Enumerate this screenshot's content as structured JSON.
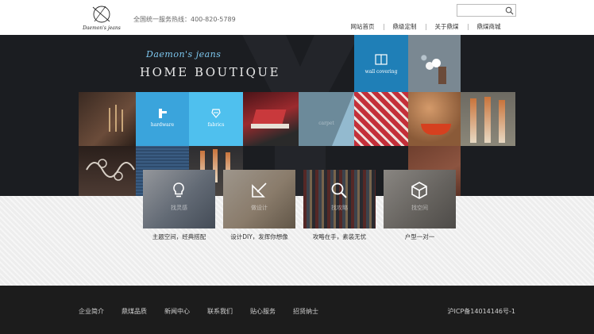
{
  "header": {
    "brand_logo": "Daemon's jeans",
    "hotline": "全国统一服务热线：400-820-5789",
    "search_placeholder": "",
    "nav": [
      {
        "label": "网站首页"
      },
      {
        "label": "鼎级定制"
      },
      {
        "label": "关于鼎煤"
      },
      {
        "label": "鼎煤商城"
      }
    ]
  },
  "hero": {
    "brand_script": "Daemon's jeans",
    "brand_big": "HOME BOUTIQUE",
    "tiles": [
      {
        "label": "wall covering",
        "icon": "book-icon"
      },
      {
        "label": "hardware",
        "icon": "hook-icon"
      },
      {
        "label": "fabrics",
        "icon": "fabric-icon"
      },
      {
        "label": "carpet",
        "icon": "carpet-icon"
      }
    ]
  },
  "features": [
    {
      "title": "找灵感",
      "caption": "主题空间，经典搭配",
      "icon": "lightbulb-icon"
    },
    {
      "title": "做设计",
      "caption": "设计DIY，发挥你想像",
      "icon": "design-icon"
    },
    {
      "title": "找攻略",
      "caption": "攻略在手，素装无忧",
      "icon": "search-icon"
    },
    {
      "title": "找空间",
      "caption": "户型一对一",
      "icon": "cube-icon"
    }
  ],
  "footer": {
    "links": [
      {
        "label": "企业简介"
      },
      {
        "label": "鼎煤品质"
      },
      {
        "label": "新闻中心"
      },
      {
        "label": "联系我们"
      },
      {
        "label": "贴心服务"
      },
      {
        "label": "招贤纳士"
      }
    ],
    "icp": "沪ICP备14014146号-1"
  },
  "colors": {
    "hero_bg": "#1b1d21",
    "accent_blue": "#4fb8e8",
    "deep_blue": "#1f7fb7",
    "footer_bg": "#1c1c1c"
  }
}
